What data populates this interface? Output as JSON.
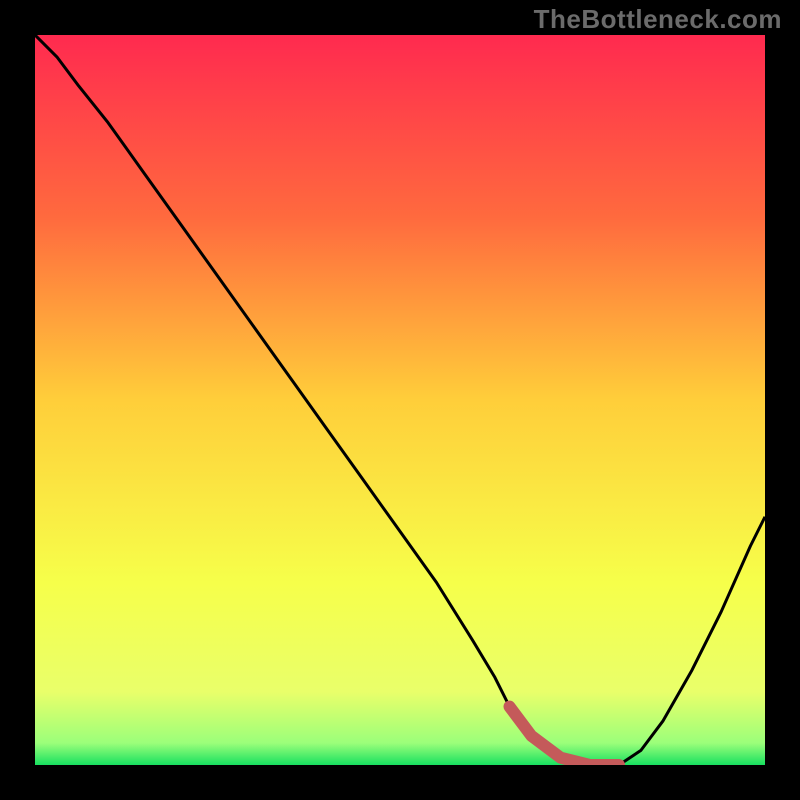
{
  "watermark": "TheBottleneck.com",
  "chart_data": {
    "type": "line",
    "title": "",
    "xlabel": "",
    "ylabel": "",
    "xlim": [
      0,
      100
    ],
    "ylim": [
      0,
      100
    ],
    "x": [
      0,
      3,
      6,
      10,
      15,
      20,
      25,
      30,
      35,
      40,
      45,
      50,
      55,
      60,
      63,
      65,
      68,
      72,
      76,
      78,
      80,
      83,
      86,
      90,
      94,
      98,
      100
    ],
    "values": [
      100,
      97,
      93,
      88,
      81,
      74,
      67,
      60,
      53,
      46,
      39,
      32,
      25,
      17,
      12,
      8,
      4,
      1,
      0,
      0,
      0,
      2,
      6,
      13,
      21,
      30,
      34
    ],
    "highlight": {
      "x_start": 65,
      "x_end": 80,
      "color": "#c45a5a"
    },
    "gradient_stops": [
      {
        "offset": 0.0,
        "color": "#ff2a4f"
      },
      {
        "offset": 0.25,
        "color": "#ff6a3e"
      },
      {
        "offset": 0.5,
        "color": "#ffce3a"
      },
      {
        "offset": 0.75,
        "color": "#f6ff4a"
      },
      {
        "offset": 0.9,
        "color": "#e9ff6a"
      },
      {
        "offset": 0.97,
        "color": "#9bff7a"
      },
      {
        "offset": 1.0,
        "color": "#18e060"
      }
    ]
  }
}
